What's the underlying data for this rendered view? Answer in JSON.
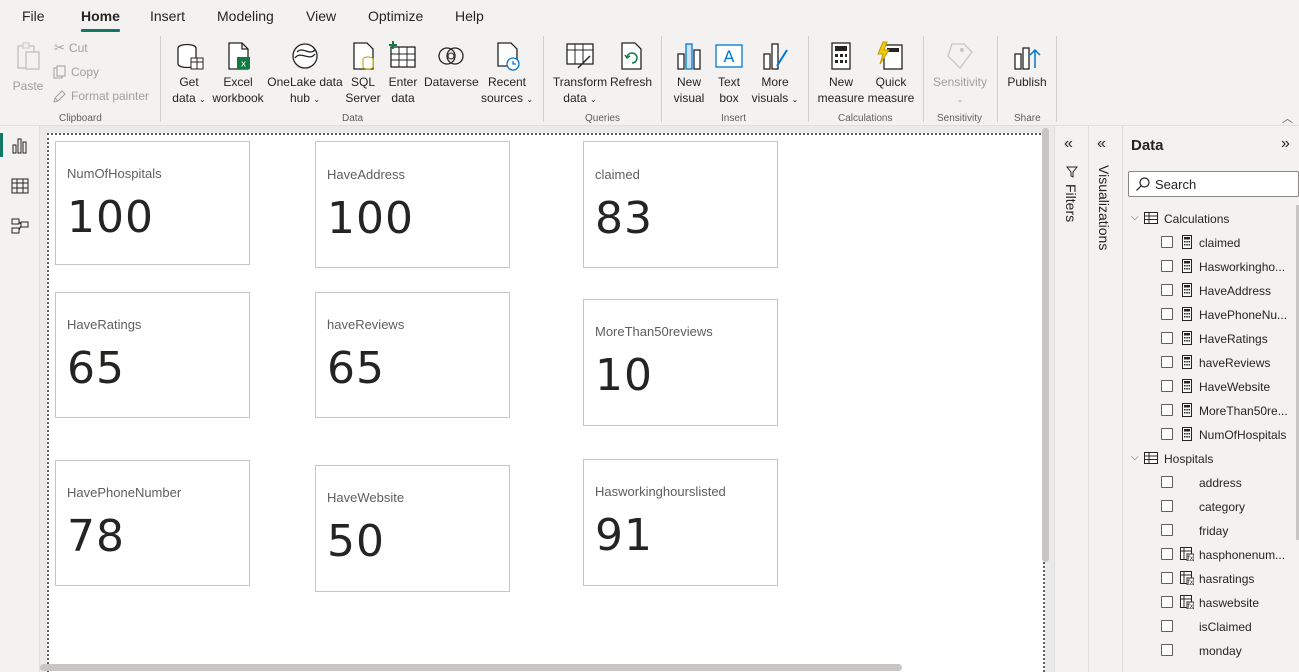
{
  "menu": {
    "tabs": [
      "File",
      "Home",
      "Insert",
      "Modeling",
      "View",
      "Optimize",
      "Help"
    ],
    "active": "Home"
  },
  "ribbon": {
    "clipboard": {
      "paste": "Paste",
      "cut": "Cut",
      "copy": "Copy",
      "format_painter": "Format painter",
      "label": "Clipboard"
    },
    "data": {
      "get_data": [
        "Get",
        "data"
      ],
      "excel": [
        "Excel",
        "workbook"
      ],
      "onelake": [
        "OneLake data",
        "hub"
      ],
      "sql": [
        "SQL",
        "Server"
      ],
      "enter": [
        "Enter",
        "data"
      ],
      "dataverse": "Dataverse",
      "recent": [
        "Recent",
        "sources"
      ],
      "label": "Data"
    },
    "queries": {
      "transform": [
        "Transform",
        "data"
      ],
      "refresh": "Refresh",
      "label": "Queries"
    },
    "insert": {
      "new_visual": [
        "New",
        "visual"
      ],
      "text_box": [
        "Text",
        "box"
      ],
      "more_visuals": [
        "More",
        "visuals"
      ],
      "label": "Insert"
    },
    "calculations": {
      "new_measure": [
        "New",
        "measure"
      ],
      "quick_measure": [
        "Quick",
        "measure"
      ],
      "label": "Calculations"
    },
    "sensitivity": {
      "button": "Sensitivity",
      "label": "Sensitivity"
    },
    "share": {
      "publish": "Publish",
      "label": "Share"
    }
  },
  "cards": [
    {
      "title": "NumOfHospitals",
      "value": "100"
    },
    {
      "title": "HaveAddress",
      "value": "100"
    },
    {
      "title": "claimed",
      "value": "83"
    },
    {
      "title": "HaveRatings",
      "value": "65"
    },
    {
      "title": "haveReviews",
      "value": "65"
    },
    {
      "title": "MoreThan50reviews",
      "value": "10"
    },
    {
      "title": "HavePhoneNumber",
      "value": "78"
    },
    {
      "title": "HaveWebsite",
      "value": "50"
    },
    {
      "title": "Hasworkinghourslisted",
      "value": "91"
    }
  ],
  "panes": {
    "filters": "Filters",
    "visualizations": "Visualizations",
    "data": {
      "title": "Data",
      "search_placeholder": "Search",
      "tables": [
        {
          "name": "Calculations",
          "fields": [
            "claimed",
            "Hasworkingho...",
            "HaveAddress",
            "HavePhoneNu...",
            "HaveRatings",
            "haveReviews",
            "HaveWebsite",
            "MoreThan50re...",
            "NumOfHospitals"
          ]
        },
        {
          "name": "Hospitals",
          "fields": [
            "address",
            "category",
            "friday",
            "hasphonenum...",
            "hasratings",
            "haswebsite",
            "isClaimed",
            "monday"
          ]
        }
      ]
    }
  }
}
